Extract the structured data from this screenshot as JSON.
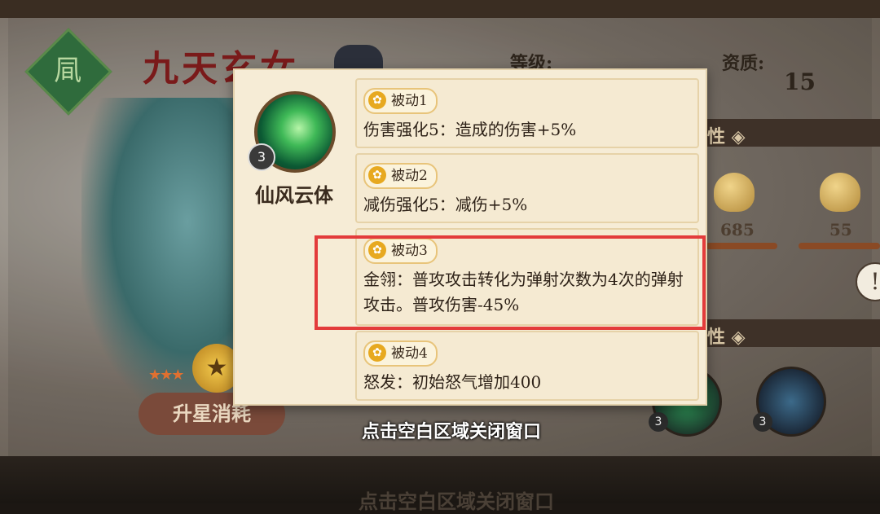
{
  "hero": {
    "faction_glyph": "凬",
    "name": "九天玄女",
    "level_label": "等级:",
    "quality_label": "资质:",
    "quality_value": "15",
    "section1_partial": "性 ◈",
    "section2_partial": "性 ◈",
    "attrs": [
      {
        "icon": "shield-icon",
        "value": "685"
      },
      {
        "icon": "helmet-icon",
        "value": "55"
      }
    ],
    "upgrade_label": "升星消耗",
    "info_symbol": "!",
    "thumb_levels": [
      "3",
      "3"
    ]
  },
  "popup": {
    "skill_name": "仙风云体",
    "skill_level": "3",
    "passives": [
      {
        "label": "被动1",
        "desc": "伤害强化5：造成的伤害+5%"
      },
      {
        "label": "被动2",
        "desc": "减伤强化5：减伤+5%"
      },
      {
        "label": "被动3",
        "desc": "金翎：普攻攻击转化为弹射次数为4次的弹射攻击。普攻伤害-45%"
      },
      {
        "label": "被动4",
        "desc": "怒发：初始怒气增加400"
      }
    ]
  },
  "close_hint": "点击空白区域关闭窗口",
  "bottom_ghost_text": "点击空白区域关闭窗口",
  "colors": {
    "highlight_border": "#e33b3b",
    "popup_bg": "#f6ecd6",
    "tag_icon": "#e7a920"
  }
}
